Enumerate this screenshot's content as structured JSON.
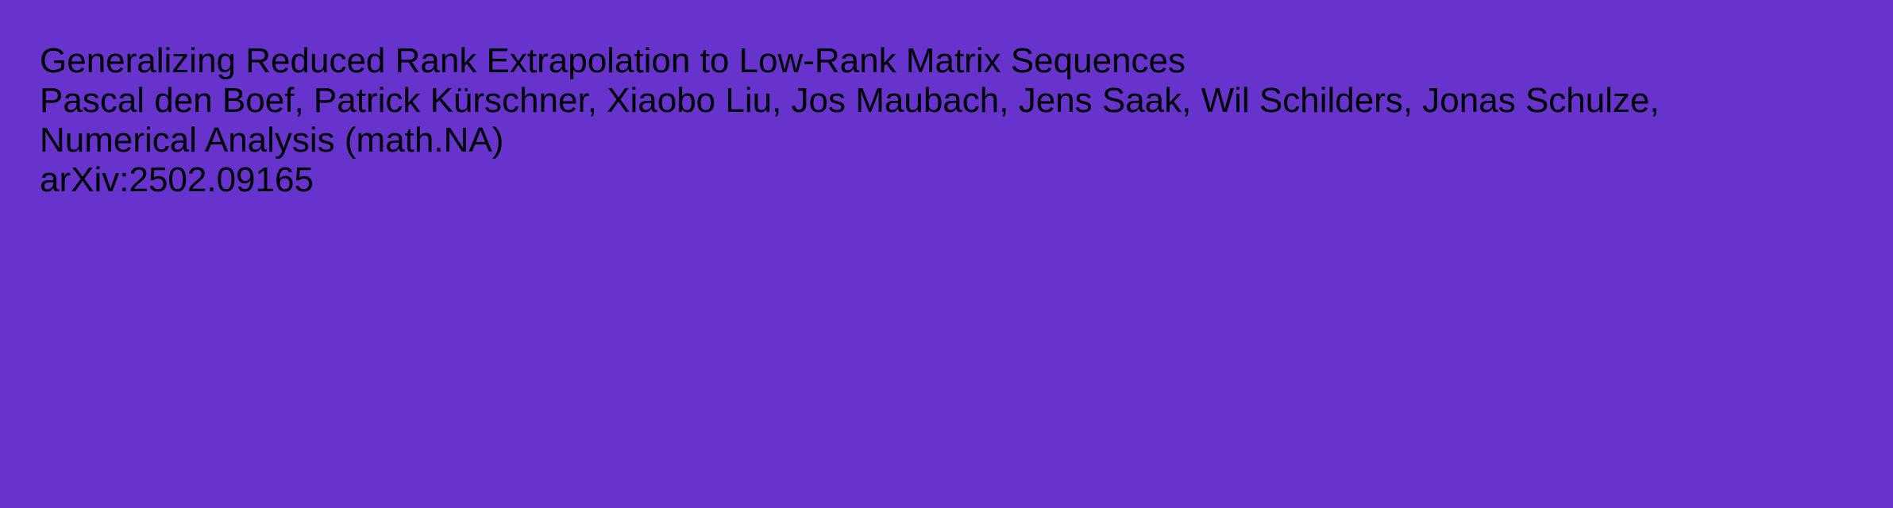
{
  "theme": {
    "background": "#6633cc",
    "text": "#000000"
  },
  "paper": {
    "title": "Generalizing Reduced Rank Extrapolation to Low-Rank Matrix Sequences",
    "authors": "Pascal den Boef, Patrick Kürschner, Xiaobo Liu, Jos Maubach, Jens Saak, Wil Schilders, Jonas Schulze,",
    "category": "Numerical Analysis (math.NA)",
    "arxiv_id": "arXiv:2502.09165"
  }
}
